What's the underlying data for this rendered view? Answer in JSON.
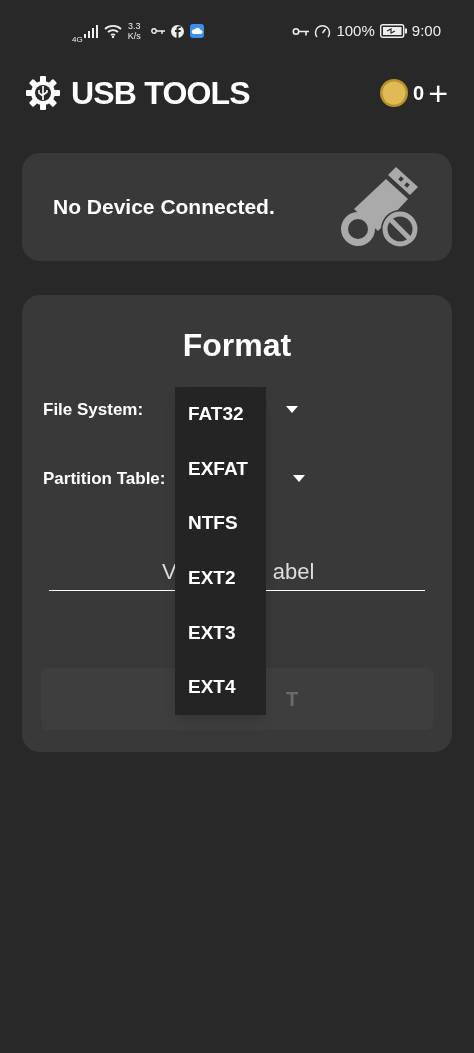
{
  "status_bar": {
    "network": "4G",
    "speed_value": "3.3",
    "speed_unit": "K/s",
    "battery": "100%",
    "time": "9:00"
  },
  "header": {
    "title": "USB TOOLS",
    "coins": "0",
    "add": "+"
  },
  "device_card": {
    "message": "No Device Connected."
  },
  "format_card": {
    "title": "Format",
    "fields": [
      {
        "label": "File System:"
      },
      {
        "label": "Partition Table:"
      }
    ],
    "volume_label": {
      "visible_start": "V",
      "visible_end": "abel"
    },
    "button": {
      "visible_text": "T",
      "disabled": true
    }
  },
  "menu": {
    "items": [
      {
        "label": "FAT32"
      },
      {
        "label": "EXFAT"
      },
      {
        "label": "NTFS"
      },
      {
        "label": "EXT2"
      },
      {
        "label": "EXT3"
      },
      {
        "label": "EXT4"
      }
    ]
  }
}
